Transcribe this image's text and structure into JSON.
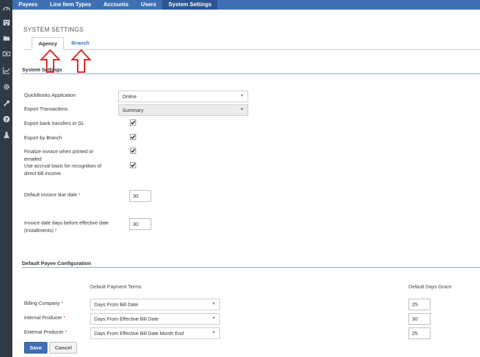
{
  "nav": {
    "items": [
      "Payees",
      "Line Item Types",
      "Accounts",
      "Users",
      "System Settings"
    ],
    "active_index": 4
  },
  "page_title": "SYSTEM SETTINGS",
  "tabs": [
    {
      "label": "Agency",
      "active": true
    },
    {
      "label": "Branch",
      "active": false
    }
  ],
  "system_settings": {
    "heading": "System Settings",
    "quickbooks": {
      "label": "QuickBooks Application",
      "value": "Online"
    },
    "export_transactions": {
      "label": "Export Transactions",
      "value": "Summary"
    },
    "export_bank_transfers": {
      "label": "Export bank transfers to GL",
      "checked": true
    },
    "export_by_branch": {
      "label": "Export by Branch",
      "checked": true
    },
    "finalize_invoice": {
      "label": "Finalize invoice when printed or emailed",
      "checked": true
    },
    "accrual_basis": {
      "label": "Use accrual basis for recognition of direct bill income",
      "checked": true
    },
    "invoice_due_date": {
      "label": "Default invoice due date",
      "required": "*",
      "value": "30"
    },
    "invoice_days_before": {
      "label": "Invoice date days before effective date (installments)",
      "required": "*",
      "value": "30"
    }
  },
  "payee_config": {
    "heading": "Default Payee Configuration",
    "col_payment_terms": "Default Payment Terms",
    "col_days_grace": "Default Days Grace",
    "rows": [
      {
        "label": "Billing Company",
        "required": "*",
        "terms": "Days From Bill Date",
        "grace": "25"
      },
      {
        "label": "Internal Producer",
        "required": "*",
        "terms": "Days From Effective Bill Date",
        "grace": "30"
      },
      {
        "label": "External Producer",
        "required": "*",
        "terms": "Days From Effective Bill Date Month End",
        "grace": "25"
      }
    ]
  },
  "buttons": {
    "save": "Save",
    "cancel": "Cancel"
  },
  "colors": {
    "nav": "#3f6fb3",
    "nav_active": "#2c5592",
    "rail": "#2f3a45",
    "arrow": "#e02020"
  },
  "icons": [
    "dashboard-icon",
    "building-icon",
    "folder-icon",
    "money-icon",
    "chart-icon",
    "gear-icon",
    "wrench-icon",
    "help-icon",
    "flask-icon"
  ]
}
